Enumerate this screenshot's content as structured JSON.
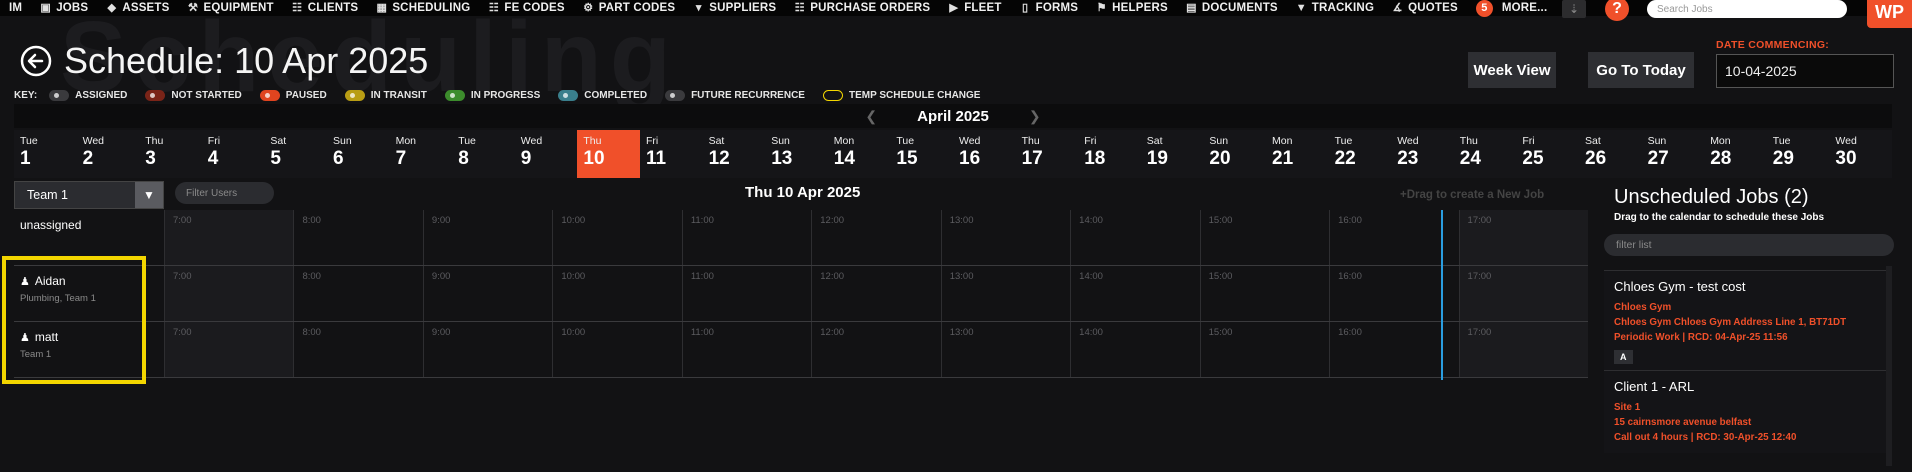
{
  "nav": {
    "items": [
      {
        "label": "IM",
        "icon": ""
      },
      {
        "label": "JOBS",
        "icon": "briefcase-icon"
      },
      {
        "label": "ASSETS",
        "icon": "cube-icon"
      },
      {
        "label": "EQUIPMENT",
        "icon": "tools-icon"
      },
      {
        "label": "CLIENTS",
        "icon": "sitemap-icon"
      },
      {
        "label": "SCHEDULING",
        "icon": "calendar-icon"
      },
      {
        "label": "FE CODES",
        "icon": "document-icon"
      },
      {
        "label": "PART CODES",
        "icon": "gears-icon"
      },
      {
        "label": "SUPPLIERS",
        "icon": "cart-icon"
      },
      {
        "label": "PURCHASE ORDERS",
        "icon": "document-icon"
      },
      {
        "label": "FLEET",
        "icon": "truck-icon"
      },
      {
        "label": "FORMS",
        "icon": "clipboard-icon"
      },
      {
        "label": "HELPERS",
        "icon": "helper-icon"
      },
      {
        "label": "DOCUMENTS",
        "icon": "documents-icon"
      },
      {
        "label": "TRACKING",
        "icon": "location-pin-icon"
      },
      {
        "label": "QUOTES",
        "icon": "paperclip-icon"
      }
    ],
    "more_count": "5",
    "more_label": "MORE...",
    "help_label": "?",
    "search_placeholder": "Search Jobs",
    "logo_text": "WP"
  },
  "watermark": "Scheduling",
  "header": {
    "title": "Schedule: 10 Apr 2025",
    "week_view": "Week View",
    "go_to_today": "Go To Today",
    "date_commencing_label": "DATE COMMENCING:",
    "date_commencing_value": "10-04-2025"
  },
  "key": {
    "label": "KEY:",
    "items": [
      {
        "label": "ASSIGNED",
        "color": "#3a3a3d",
        "outline": false
      },
      {
        "label": "NOT STARTED",
        "color": "#7a2418",
        "outline": false
      },
      {
        "label": "PAUSED",
        "color": "#e0441f",
        "outline": false
      },
      {
        "label": "IN TRANSIT",
        "color": "#b89d14",
        "outline": false
      },
      {
        "label": "IN PROGRESS",
        "color": "#3c8c2c",
        "outline": false
      },
      {
        "label": "COMPLETED",
        "color": "#3a7f8c",
        "outline": false
      },
      {
        "label": "FUTURE RECURRENCE",
        "color": "#3a3a3d",
        "outline": false
      },
      {
        "label": "TEMP SCHEDULE CHANGE",
        "color": "#f3d600",
        "outline": true
      }
    ]
  },
  "calendar": {
    "month": "April 2025",
    "days": [
      {
        "name": "Tue",
        "num": "1"
      },
      {
        "name": "Wed",
        "num": "2"
      },
      {
        "name": "Thu",
        "num": "3"
      },
      {
        "name": "Fri",
        "num": "4"
      },
      {
        "name": "Sat",
        "num": "5"
      },
      {
        "name": "Sun",
        "num": "6"
      },
      {
        "name": "Mon",
        "num": "7"
      },
      {
        "name": "Tue",
        "num": "8"
      },
      {
        "name": "Wed",
        "num": "9"
      },
      {
        "name": "Thu",
        "num": "10"
      },
      {
        "name": "Fri",
        "num": "11"
      },
      {
        "name": "Sat",
        "num": "12"
      },
      {
        "name": "Sun",
        "num": "13"
      },
      {
        "name": "Mon",
        "num": "14"
      },
      {
        "name": "Tue",
        "num": "15"
      },
      {
        "name": "Wed",
        "num": "16"
      },
      {
        "name": "Thu",
        "num": "17"
      },
      {
        "name": "Fri",
        "num": "18"
      },
      {
        "name": "Sat",
        "num": "19"
      },
      {
        "name": "Sun",
        "num": "20"
      },
      {
        "name": "Mon",
        "num": "21"
      },
      {
        "name": "Tue",
        "num": "22"
      },
      {
        "name": "Wed",
        "num": "23"
      },
      {
        "name": "Thu",
        "num": "24"
      },
      {
        "name": "Fri",
        "num": "25"
      },
      {
        "name": "Sat",
        "num": "26"
      },
      {
        "name": "Sun",
        "num": "27"
      },
      {
        "name": "Mon",
        "num": "28"
      },
      {
        "name": "Tue",
        "num": "29"
      },
      {
        "name": "Wed",
        "num": "30"
      }
    ],
    "selected_day": "10"
  },
  "scheduler": {
    "team": "Team 1",
    "filter_placeholder": "Filter Users",
    "day_heading": "Thu 10 Apr 2025",
    "drag_hint": "+Drag to create a New Job",
    "hours": [
      "7:00",
      "8:00",
      "9:00",
      "10:00",
      "11:00",
      "12:00",
      "13:00",
      "14:00",
      "15:00",
      "16:00",
      "17:00"
    ],
    "rows": [
      {
        "name": "unassigned",
        "sub": "",
        "person": false
      },
      {
        "name": "Aidan",
        "sub": "Plumbing, Team 1",
        "person": true
      },
      {
        "name": "matt",
        "sub": "Team 1",
        "person": true
      }
    ]
  },
  "unscheduled": {
    "title": "Unscheduled Jobs (2)",
    "subtitle": "Drag to the calendar to schedule these Jobs",
    "filter_placeholder": "filter list",
    "jobs": [
      {
        "title": "Chloes Gym - test cost",
        "client": "Chloes Gym",
        "address": "Chloes Gym Chloes Gym Address Line 1, BT71DT",
        "detail": "Periodic Work | RCD: 04-Apr-25 11:56",
        "tag": "A"
      },
      {
        "title": "Client 1 - ARL",
        "client": "Site 1",
        "address": "15 cairnsmore avenue belfast",
        "detail": "Call out 4 hours | RCD: 30-Apr-25 12:40",
        "tag": ""
      }
    ]
  }
}
